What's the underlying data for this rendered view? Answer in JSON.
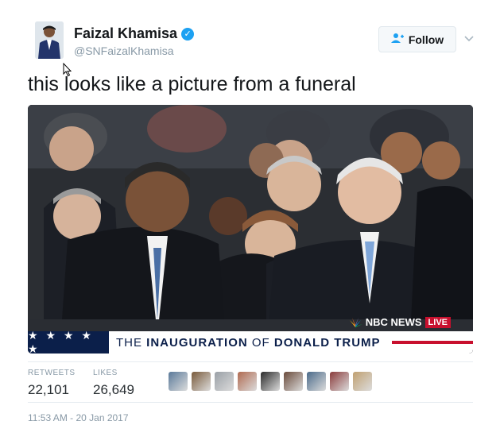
{
  "user": {
    "name": "Faizal Khamisa",
    "handle": "@SNFaizalKhamisa",
    "verified_glyph": "✓",
    "avatar_icon": "profile-photo"
  },
  "follow": {
    "label": "Follow",
    "icon": "follow-user-icon"
  },
  "tweet": {
    "text": "this looks like a picture from a funeral"
  },
  "media": {
    "lower_third_stars": "★ ★ ★ ★ ★",
    "lower_third_prefix": "THE ",
    "lower_third_bold1": "INAUGURATION",
    "lower_third_mid": " OF ",
    "lower_third_bold2": "DONALD TRUMP",
    "network": "NBC NEWS",
    "live": "LIVE"
  },
  "stats": {
    "retweets_label": "RETWEETS",
    "retweets_value": "22,101",
    "likes_label": "LIKES",
    "likes_value": "26,649"
  },
  "likers": [
    "#5a7a9a",
    "#7a5a3a",
    "#9aa0a6",
    "#b06a50",
    "#2a2a2a",
    "#6a4a3a",
    "#4a6a8a",
    "#8a3a3a",
    "#c0a070"
  ],
  "timestamp": "11:53 AM - 20 Jan 2017"
}
